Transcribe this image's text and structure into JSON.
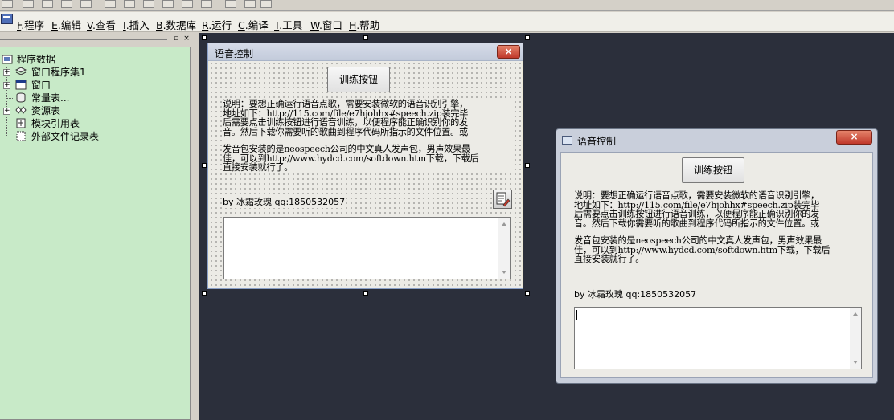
{
  "menu": [
    {
      "key": "F",
      "rest": ".程序"
    },
    {
      "key": "E",
      "rest": ".编辑"
    },
    {
      "key": "V",
      "rest": ".查看"
    },
    {
      "key": "I",
      "rest": ".插入"
    },
    {
      "key": "B",
      "rest": ".数据库"
    },
    {
      "key": "R",
      "rest": ".运行"
    },
    {
      "key": "C",
      "rest": ".编译"
    },
    {
      "key": "T",
      "rest": ".工具"
    },
    {
      "key": "W",
      "rest": ".窗口"
    },
    {
      "key": "H",
      "rest": ".帮助"
    }
  ],
  "panel": {
    "pin": "▫",
    "close": "×"
  },
  "tree": {
    "root": "程序数据",
    "items": [
      "窗口程序集1",
      "窗口",
      "常量表...",
      "资源表",
      "模块引用表",
      "外部文件记录表"
    ]
  },
  "design_form": {
    "title": "语音控制",
    "close": "×",
    "train_button": "训练按钮",
    "desc1_a": "说明：要想正确运行语音点歌，需要安装微软的语音识别引擎，",
    "desc1_b": "地址如下：",
    "desc1_url": "http://115.com/file/e7hjohhx#speech.zip",
    "desc1_c": "装完毕",
    "desc1_d": "后需要点击训练按钮进行语音训练，以便程序能正确识别你的发",
    "desc1_e": "音。然后下载你需要听的歌曲到程序代码所指示的文件位置。或",
    "desc2_a": "发音包安装的是",
    "desc2_brand": "neospeech",
    "desc2_b": "公司的中文真人发声包，男声效果最",
    "desc2_c": "佳，可以到",
    "desc2_url": "http://www.hydcd.com/softdown.htm",
    "desc2_d": "下载，下载后",
    "desc2_e": "直接安装就行了。",
    "by": "by 冰霜玫瑰 qq:1850532057"
  },
  "run_window": {
    "title": "语音控制",
    "close": "×",
    "train_button": "训练按钮",
    "by": "by 冰霜玫瑰 qq:1850532057"
  }
}
